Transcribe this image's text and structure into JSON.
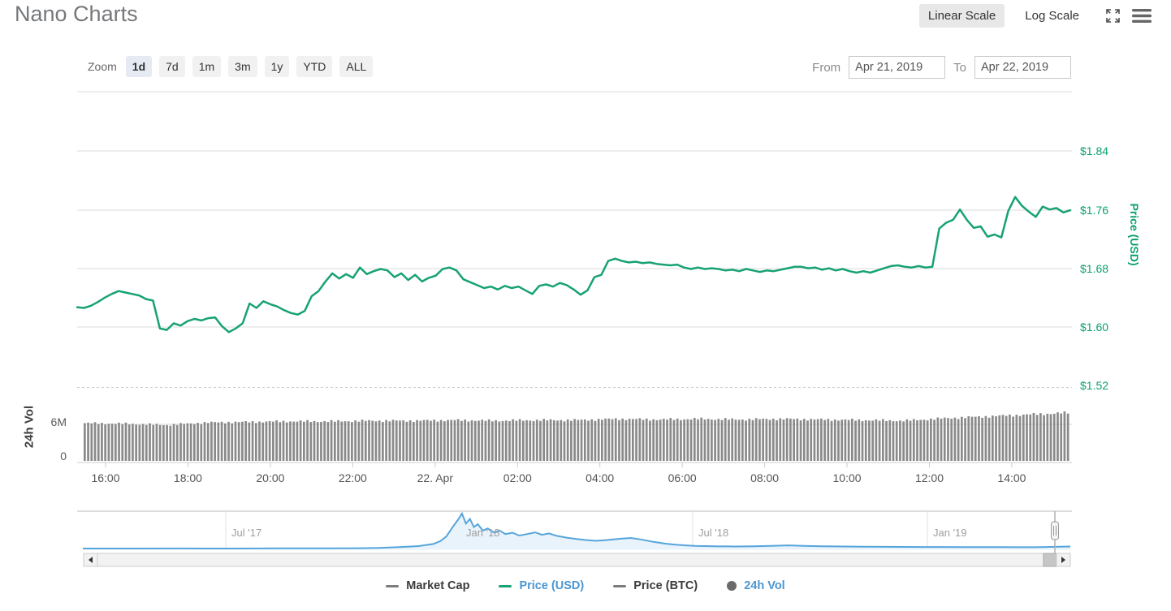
{
  "header": {
    "title": "Nano Charts",
    "linear_scale_label": "Linear Scale",
    "log_scale_label": "Log Scale"
  },
  "toolbar": {
    "zoom_label": "Zoom",
    "ranges": [
      {
        "label": "1d",
        "active": true
      },
      {
        "label": "7d",
        "active": false
      },
      {
        "label": "1m",
        "active": false
      },
      {
        "label": "3m",
        "active": false
      },
      {
        "label": "1y",
        "active": false
      },
      {
        "label": "YTD",
        "active": false
      },
      {
        "label": "ALL",
        "active": false
      }
    ],
    "from_label": "From",
    "from_value": "Apr 21, 2019",
    "to_label": "To",
    "to_value": "Apr 22, 2019"
  },
  "colors": {
    "price_line": "#17a274",
    "price_axis_text": "#0ca071",
    "volume_bar": "#8a8a8a",
    "nav_line": "#55a5dc",
    "nav_fill": "#e9f3fb",
    "legend_active_text": "#4a96d2",
    "legend_inactive_text": "#3b3b3b",
    "grid": "#ededed"
  },
  "chart_data": [
    {
      "type": "line",
      "name": "Price (USD)",
      "pane": "price",
      "axis_title": "Price (USD)",
      "y_ticks": [
        "$1.52",
        "$1.60",
        "$1.68",
        "$1.76",
        "$1.84"
      ],
      "y_tick_values": [
        1.52,
        1.6,
        1.68,
        1.76,
        1.84
      ],
      "ylim": [
        1.505,
        1.925
      ],
      "x_labels": [
        "16:00",
        "18:00",
        "20:00",
        "22:00",
        "22. Apr",
        "02:00",
        "04:00",
        "06:00",
        "08:00",
        "10:00",
        "12:00",
        "14:00"
      ],
      "start": "Apr 21, 2019 15:20",
      "end": "Apr 22, 2019 15:20",
      "interval_minutes": 10,
      "values": [
        1.627,
        1.626,
        1.629,
        1.634,
        1.64,
        1.645,
        1.649,
        1.647,
        1.645,
        1.643,
        1.638,
        1.636,
        1.598,
        1.596,
        1.605,
        1.602,
        1.608,
        1.611,
        1.609,
        1.612,
        1.613,
        1.601,
        1.593,
        1.598,
        1.605,
        1.632,
        1.626,
        1.635,
        1.631,
        1.628,
        1.623,
        1.619,
        1.617,
        1.622,
        1.642,
        1.649,
        1.662,
        1.673,
        1.666,
        1.672,
        1.667,
        1.681,
        1.672,
        1.676,
        1.679,
        1.677,
        1.668,
        1.673,
        1.664,
        1.671,
        1.662,
        1.667,
        1.67,
        1.679,
        1.681,
        1.677,
        1.665,
        1.661,
        1.657,
        1.653,
        1.655,
        1.651,
        1.656,
        1.653,
        1.655,
        1.65,
        1.645,
        1.656,
        1.658,
        1.655,
        1.66,
        1.657,
        1.651,
        1.644,
        1.65,
        1.668,
        1.671,
        1.69,
        1.693,
        1.69,
        1.688,
        1.689,
        1.687,
        1.688,
        1.686,
        1.685,
        1.684,
        1.685,
        1.681,
        1.679,
        1.681,
        1.679,
        1.68,
        1.679,
        1.677,
        1.678,
        1.676,
        1.679,
        1.677,
        1.675,
        1.677,
        1.676,
        1.678,
        1.68,
        1.682,
        1.682,
        1.68,
        1.681,
        1.678,
        1.68,
        1.677,
        1.679,
        1.676,
        1.674,
        1.676,
        1.674,
        1.677,
        1.68,
        1.683,
        1.684,
        1.682,
        1.681,
        1.683,
        1.681,
        1.682,
        1.734,
        1.742,
        1.746,
        1.76,
        1.746,
        1.735,
        1.737,
        1.723,
        1.726,
        1.722,
        1.758,
        1.777,
        1.765,
        1.757,
        1.75,
        1.764,
        1.76,
        1.762,
        1.756,
        1.759
      ]
    },
    {
      "type": "bar",
      "name": "24h Vol",
      "pane": "volume",
      "axis_title": "24h Vol",
      "y_ticks": [
        "0",
        "6M"
      ],
      "y_tick_values_millions": [
        0,
        6
      ],
      "unit": "millions USD",
      "hourly_values_millions": [
        6.2,
        6.1,
        5.9,
        6.3,
        6.4,
        6.5,
        6.5,
        6.6,
        6.6,
        6.7,
        6.6,
        6.7,
        6.7,
        6.9,
        6.8,
        6.9,
        6.8,
        6.9,
        6.8,
        6.7,
        6.6,
        7.0,
        7.3,
        7.6,
        7.9
      ]
    },
    {
      "type": "area",
      "name": "all-time overview (navigator)",
      "pane": "navigator",
      "x_labels": [
        "Jul '17",
        "Jan '18",
        "Jul '18",
        "Jan '19"
      ],
      "note": "values normalized to all-time peak (Jan 2018)",
      "points": [
        [
          0.0,
          0.012
        ],
        [
          0.05,
          0.012
        ],
        [
          0.1,
          0.013
        ],
        [
          0.15,
          0.012
        ],
        [
          0.2,
          0.015
        ],
        [
          0.25,
          0.018
        ],
        [
          0.28,
          0.02
        ],
        [
          0.3,
          0.03
        ],
        [
          0.32,
          0.05
        ],
        [
          0.34,
          0.08
        ],
        [
          0.355,
          0.14
        ],
        [
          0.362,
          0.22
        ],
        [
          0.368,
          0.35
        ],
        [
          0.374,
          0.6
        ],
        [
          0.38,
          0.83
        ],
        [
          0.384,
          1.0
        ],
        [
          0.388,
          0.72
        ],
        [
          0.392,
          0.85
        ],
        [
          0.396,
          0.62
        ],
        [
          0.4,
          0.7
        ],
        [
          0.405,
          0.52
        ],
        [
          0.41,
          0.58
        ],
        [
          0.416,
          0.47
        ],
        [
          0.422,
          0.52
        ],
        [
          0.428,
          0.42
        ],
        [
          0.435,
          0.46
        ],
        [
          0.442,
          0.38
        ],
        [
          0.45,
          0.42
        ],
        [
          0.458,
          0.47
        ],
        [
          0.465,
          0.4
        ],
        [
          0.472,
          0.44
        ],
        [
          0.48,
          0.37
        ],
        [
          0.49,
          0.32
        ],
        [
          0.5,
          0.28
        ],
        [
          0.51,
          0.25
        ],
        [
          0.52,
          0.23
        ],
        [
          0.53,
          0.25
        ],
        [
          0.545,
          0.29
        ],
        [
          0.555,
          0.31
        ],
        [
          0.565,
          0.27
        ],
        [
          0.578,
          0.2
        ],
        [
          0.59,
          0.15
        ],
        [
          0.6,
          0.12
        ],
        [
          0.61,
          0.1
        ],
        [
          0.62,
          0.085
        ],
        [
          0.64,
          0.075
        ],
        [
          0.66,
          0.07
        ],
        [
          0.68,
          0.075
        ],
        [
          0.7,
          0.09
        ],
        [
          0.715,
          0.1
        ],
        [
          0.73,
          0.085
        ],
        [
          0.75,
          0.075
        ],
        [
          0.77,
          0.07
        ],
        [
          0.79,
          0.065
        ],
        [
          0.81,
          0.06
        ],
        [
          0.83,
          0.058
        ],
        [
          0.85,
          0.055
        ],
        [
          0.87,
          0.055
        ],
        [
          0.89,
          0.052
        ],
        [
          0.91,
          0.05
        ],
        [
          0.93,
          0.05
        ],
        [
          0.95,
          0.048
        ],
        [
          0.97,
          0.05
        ],
        [
          0.985,
          0.06
        ],
        [
          1.0,
          0.07
        ]
      ]
    }
  ],
  "legend": [
    {
      "label": "Market Cap",
      "swatch": "line",
      "swatch_color": "#7c7c7c",
      "active": false
    },
    {
      "label": "Price (USD)",
      "swatch": "line",
      "swatch_color": "#17a274",
      "active": true
    },
    {
      "label": "Price (BTC)",
      "swatch": "line",
      "swatch_color": "#7c7c7c",
      "active": false
    },
    {
      "label": "24h Vol",
      "swatch": "circle",
      "swatch_color": "#6b6b6b",
      "active": true
    }
  ]
}
